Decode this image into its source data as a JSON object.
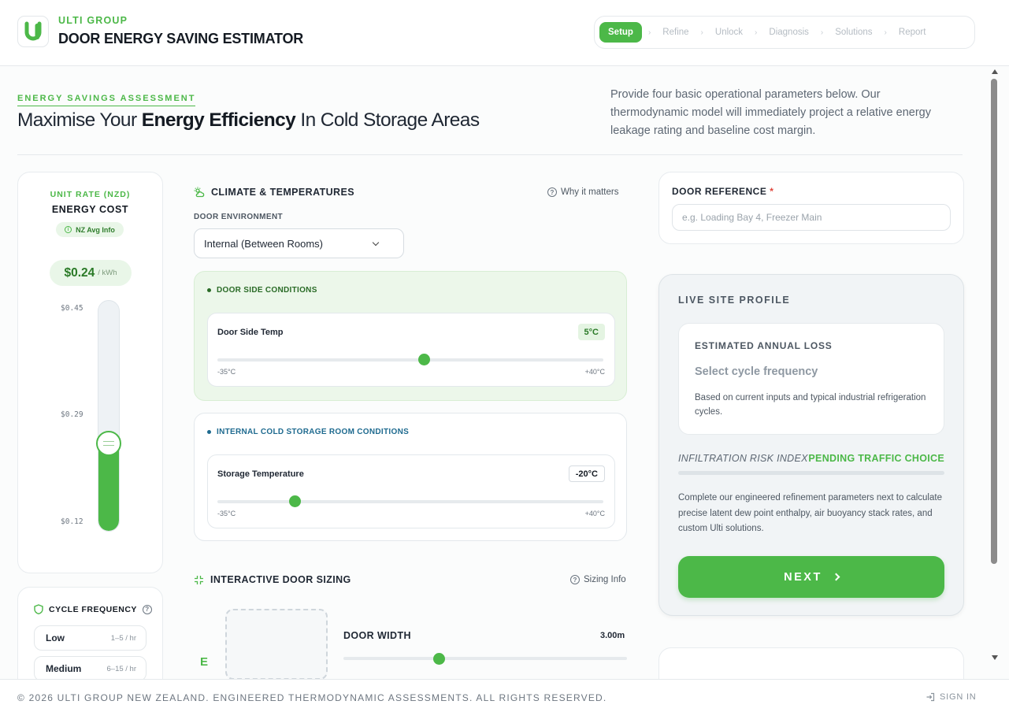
{
  "header": {
    "brand_sub": "ULTI GROUP",
    "brand_title": "DOOR ENERGY SAVING ESTIMATOR",
    "steps": [
      "Setup",
      "Refine",
      "Unlock",
      "Diagnosis",
      "Solutions",
      "Report"
    ],
    "active_step": "Setup"
  },
  "hero": {
    "eyebrow": "ENERGY SAVINGS ASSESSMENT",
    "title_pre": "Maximise Your ",
    "title_bold": "Energy Efficiency",
    "title_post": " In Cold Storage Areas",
    "description": "Provide four basic operational parameters below. Our thermodynamic model will immediately project a relative energy leakage rating and baseline cost margin."
  },
  "energy_cost": {
    "unit_label": "UNIT RATE (NZD)",
    "title": "ENERGY COST",
    "info_chip": "NZ Avg Info",
    "price": "$0.24",
    "price_unit": "/ kWh",
    "ticks": [
      "$0.45",
      "$0.29",
      "$0.12"
    ],
    "level": 0.38
  },
  "cycle_frequency": {
    "title": "CYCLE FREQUENCY",
    "options": [
      {
        "name": "Low",
        "range": "1–5 / hr"
      },
      {
        "name": "Medium",
        "range": "6–15 / hr"
      }
    ]
  },
  "climate": {
    "title": "CLIMATE & TEMPERATURES",
    "help_link": "Why it matters",
    "env_label": "DOOR ENVIRONMENT",
    "env_value": "Internal (Between Rooms)",
    "door_side": {
      "title": "DOOR SIDE CONDITIONS",
      "label": "Door Side Temp",
      "value": "5°C",
      "min": "-35°C",
      "max": "+40°C",
      "level": 0.535
    },
    "storage": {
      "title": "INTERNAL COLD STORAGE ROOM CONDITIONS",
      "label": "Storage Temperature",
      "value": "-20°C",
      "min": "-35°C",
      "max": "+40°C",
      "level": 0.2
    }
  },
  "door_sizing": {
    "title": "INTERACTIVE DOOR SIZING",
    "help_link": "Sizing Info",
    "width_label": "DOOR WIDTH",
    "width_value": "3.00m",
    "letter": "E"
  },
  "door_reference": {
    "title": "DOOR REFERENCE",
    "required_mark": "*",
    "placeholder": "e.g. Loading Bay 4, Freezer Main"
  },
  "profile": {
    "title": "LIVE SITE PROFILE",
    "loss_title": "ESTIMATED ANNUAL LOSS",
    "loss_value": "Select cycle frequency",
    "loss_desc": "Based on current inputs and typical industrial refrigeration cycles.",
    "risk_label": "INFILTRATION RISK INDEX",
    "risk_status": "PENDING TRAFFIC CHOICE",
    "description": "Complete our engineered refinement parameters next to calculate precise latent dew point enthalpy, air buoyancy stack rates, and custom Ulti solutions.",
    "next_label": "NEXT"
  },
  "footer": {
    "copyright": "© 2026 ULTI GROUP NEW ZEALAND. ENGINEERED THERMODYNAMIC ASSESSMENTS. ALL RIGHTS RESERVED.",
    "signin": "SIGN IN"
  },
  "colors": {
    "accent": "#4cb848",
    "accent_dark": "#2a7a27",
    "storage_blue": "#1e6a8f",
    "required": "#e0463c"
  }
}
